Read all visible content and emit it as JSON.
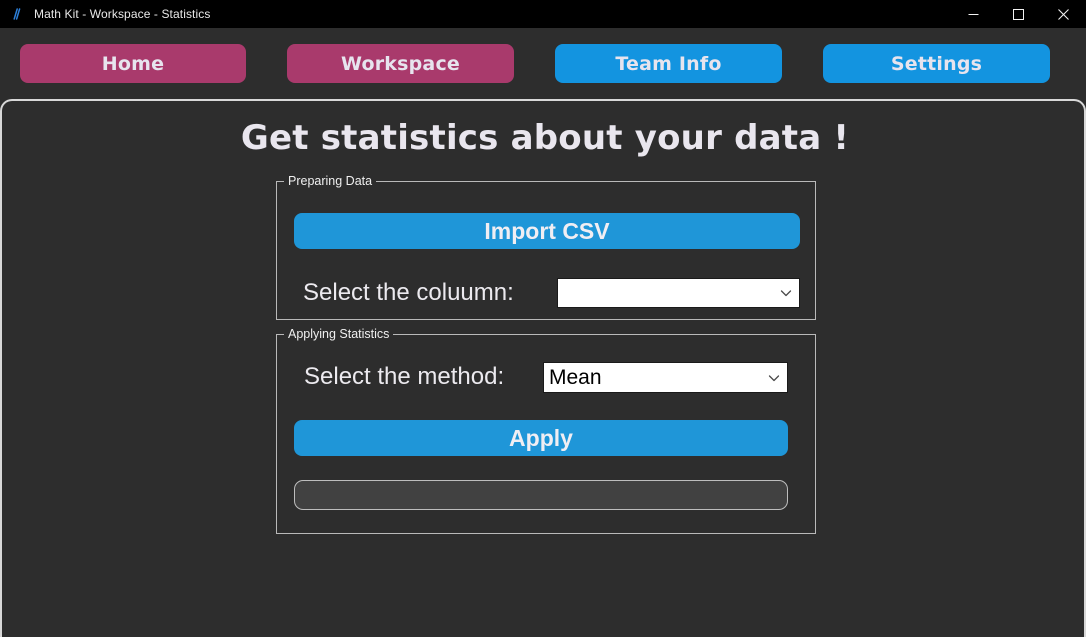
{
  "window": {
    "title": "Math Kit - Workspace - Statistics",
    "app_icon": "math-kit-icon",
    "controls": {
      "minimize": "minimize-icon",
      "maximize": "maximize-icon",
      "close": "close-icon"
    }
  },
  "nav": {
    "items": [
      {
        "label": "Home",
        "color": "#a93a6c"
      },
      {
        "label": "Workspace",
        "color": "#a93a6c"
      },
      {
        "label": "Team Info",
        "color": "#1394e0"
      },
      {
        "label": "Settings",
        "color": "#1394e0"
      }
    ]
  },
  "page": {
    "title": "Get statistics about your data !"
  },
  "preparing_data": {
    "legend": "Preparing Data",
    "import_button": "Import CSV",
    "column_label": "Select the coluumn:",
    "column_value": "",
    "column_placeholder": "",
    "dropdown_icon": "chevron-down-icon"
  },
  "applying_statistics": {
    "legend": "Applying Statistics",
    "method_label": "Select the method:",
    "method_value": "Mean",
    "apply_button": "Apply",
    "result_value": "",
    "dropdown_icon": "chevron-down-icon"
  },
  "colors": {
    "background": "#2d2d2d",
    "titlebar": "#000000",
    "accent_blue": "#1f96d8",
    "accent_magenta": "#a93a6c",
    "frame_border": "#d8d8d8",
    "text_light": "#eceaef"
  }
}
